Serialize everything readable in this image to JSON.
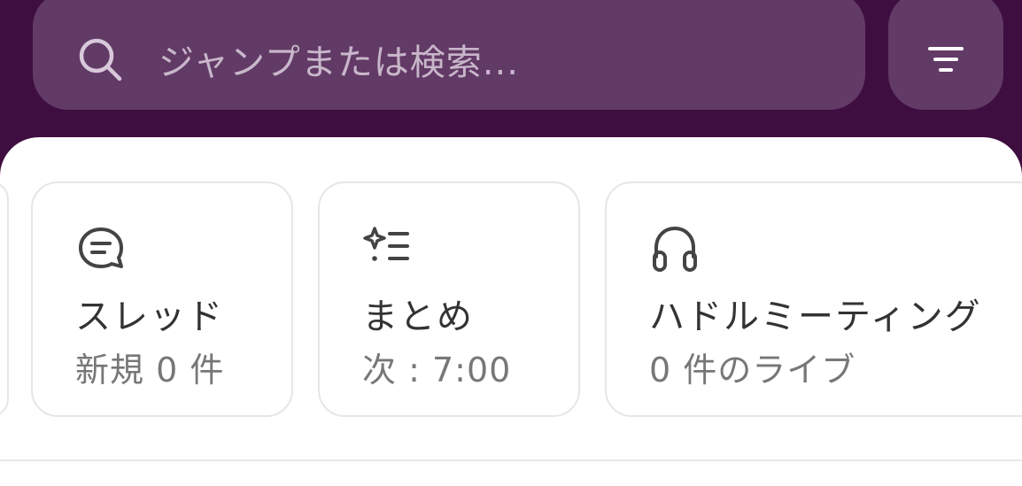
{
  "search": {
    "placeholder": "ジャンプまたは検索..."
  },
  "cards": [
    {
      "title": "スレッド",
      "sub": "新規 0 件",
      "icon": "thread-bubble-icon"
    },
    {
      "title": "まとめ",
      "sub": "次 : 7:00",
      "icon": "sparkle-list-icon"
    },
    {
      "title": "ハドルミーティング",
      "sub": "0 件のライブ",
      "icon": "headphones-icon"
    }
  ],
  "colors": {
    "header_bg": "#3f0e40",
    "search_bg": "#623a66"
  }
}
